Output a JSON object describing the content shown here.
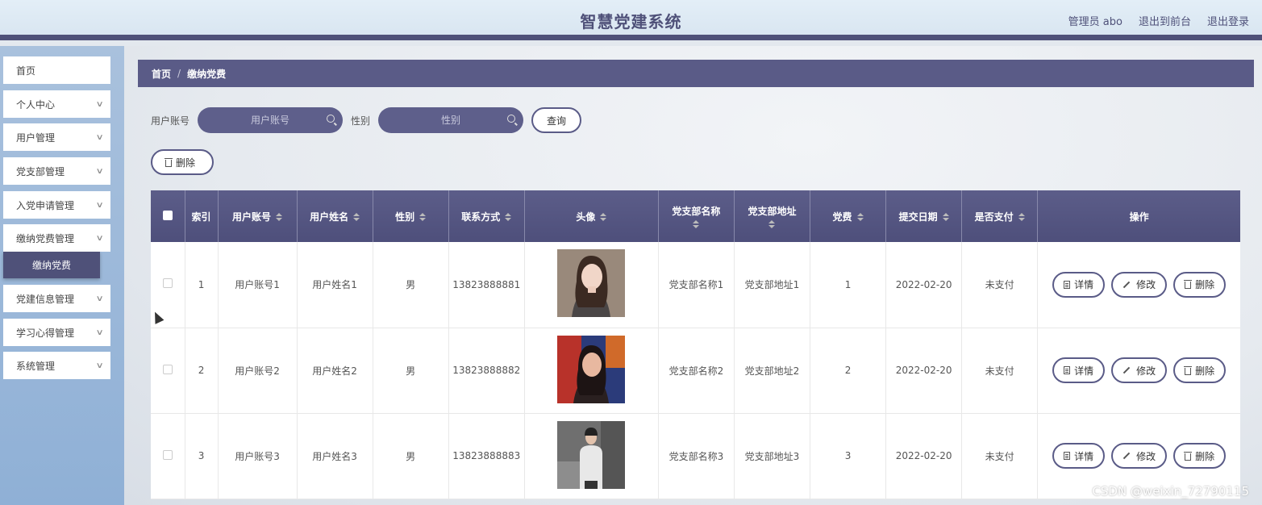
{
  "header": {
    "title": "智慧党建系统",
    "user": "管理员 abo",
    "front_link": "退出到前台",
    "logout": "退出登录"
  },
  "sidebar": {
    "items": [
      {
        "label": "首页"
      },
      {
        "label": "个人中心"
      },
      {
        "label": "用户管理"
      },
      {
        "label": "党支部管理"
      },
      {
        "label": "入党申请管理"
      },
      {
        "label": "缴纳党费管理"
      },
      {
        "label": "党建信息管理"
      },
      {
        "label": "学习心得管理"
      },
      {
        "label": "系统管理"
      }
    ],
    "active_sub": "缴纳党费"
  },
  "breadcrumb": {
    "home": "首页",
    "separator": "/",
    "current": "缴纳党费"
  },
  "search": {
    "account_label": "用户账号",
    "account_placeholder": "用户账号",
    "gender_label": "性别",
    "gender_placeholder": "性别",
    "query_button": "查询"
  },
  "toolbar": {
    "delete_button": "删除"
  },
  "table": {
    "headers": {
      "index": "索引",
      "account": "用户账号",
      "name": "用户姓名",
      "gender": "性别",
      "phone": "联系方式",
      "avatar": "头像",
      "branch_name": "党支部名称",
      "branch_address": "党支部地址",
      "fee": "党费",
      "date": "提交日期",
      "paid": "是否支付",
      "ops": "操作"
    },
    "rows": [
      {
        "index": "1",
        "account": "用户账号1",
        "name": "用户姓名1",
        "gender": "男",
        "phone": "13823888881",
        "branch_name": "党支部名称1",
        "branch_address": "党支部地址1",
        "fee": "1",
        "date": "2022-02-20",
        "paid": "未支付"
      },
      {
        "index": "2",
        "account": "用户账号2",
        "name": "用户姓名2",
        "gender": "男",
        "phone": "13823888882",
        "branch_name": "党支部名称2",
        "branch_address": "党支部地址2",
        "fee": "2",
        "date": "2022-02-20",
        "paid": "未支付"
      },
      {
        "index": "3",
        "account": "用户账号3",
        "name": "用户姓名3",
        "gender": "男",
        "phone": "13823888883",
        "branch_name": "党支部名称3",
        "branch_address": "党支部地址3",
        "fee": "3",
        "date": "2022-02-20",
        "paid": "未支付"
      }
    ],
    "actions": {
      "detail": "详情",
      "edit": "修改",
      "delete": "删除"
    }
  },
  "watermark": "CSDN @weixin_72790115",
  "colors": {
    "primary": "#4f5179",
    "header_bg": "#dde9f3",
    "sidebar_bg": "#9cb9db"
  }
}
